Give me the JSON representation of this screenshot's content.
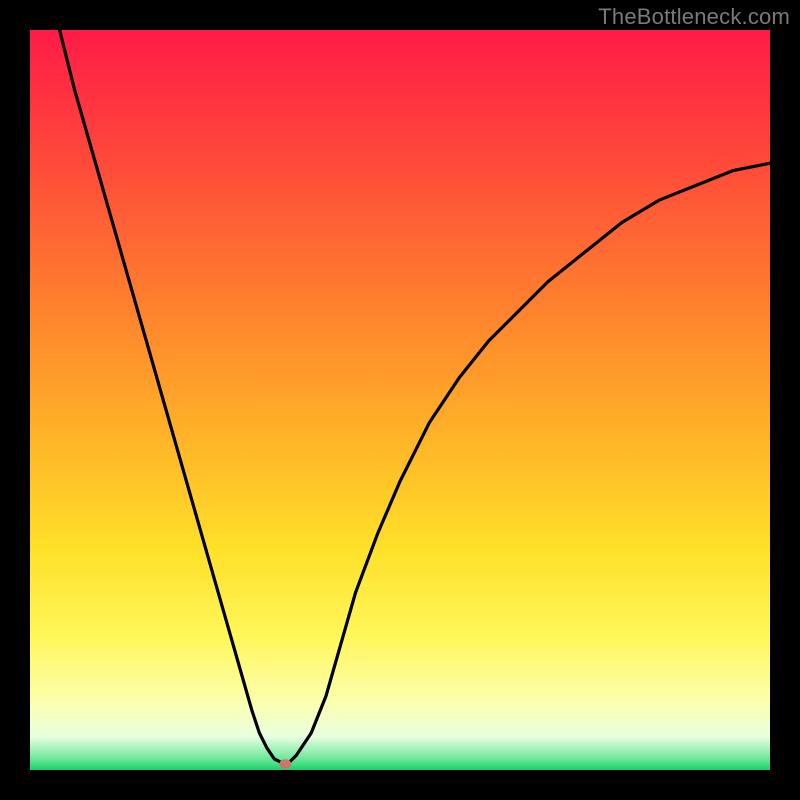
{
  "watermark": "TheBottleneck.com",
  "colors": {
    "frame_bg": "#000000",
    "line": "#000000",
    "marker_fill": "#cc7766",
    "gradient_stops": [
      {
        "offset": 0.0,
        "color": "#ff1b47"
      },
      {
        "offset": 0.18,
        "color": "#ff4a3a"
      },
      {
        "offset": 0.36,
        "color": "#ff7d2e"
      },
      {
        "offset": 0.54,
        "color": "#ffb028"
      },
      {
        "offset": 0.7,
        "color": "#ffe028"
      },
      {
        "offset": 0.82,
        "color": "#fff75a"
      },
      {
        "offset": 0.91,
        "color": "#fbffb0"
      },
      {
        "offset": 0.955,
        "color": "#e8ffe0"
      },
      {
        "offset": 0.985,
        "color": "#6de89a"
      },
      {
        "offset": 1.0,
        "color": "#17d169"
      }
    ]
  },
  "chart_data": {
    "type": "line",
    "title": "",
    "xlabel": "",
    "ylabel": "",
    "xlim": [
      0,
      100
    ],
    "ylim": [
      0,
      100
    ],
    "grid": false,
    "series": [
      {
        "name": "bottleneck-curve",
        "x": [
          4,
          6,
          8,
          10,
          12,
          14,
          16,
          18,
          20,
          22,
          24,
          26,
          28,
          30,
          31,
          32,
          33,
          34,
          35,
          36,
          38,
          40,
          42,
          44,
          47,
          50,
          54,
          58,
          62,
          66,
          70,
          75,
          80,
          85,
          90,
          95,
          100
        ],
        "y": [
          100,
          92,
          85,
          78,
          71,
          64,
          57,
          50,
          43,
          36,
          29,
          22,
          15,
          8,
          5,
          3,
          1.5,
          1,
          1,
          2,
          5,
          10,
          17,
          24,
          32,
          39,
          47,
          53,
          58,
          62,
          66,
          70,
          74,
          77,
          79,
          81,
          82
        ]
      }
    ],
    "marker": {
      "x": 34.5,
      "y": 0.8,
      "label": "optimal-point"
    }
  }
}
